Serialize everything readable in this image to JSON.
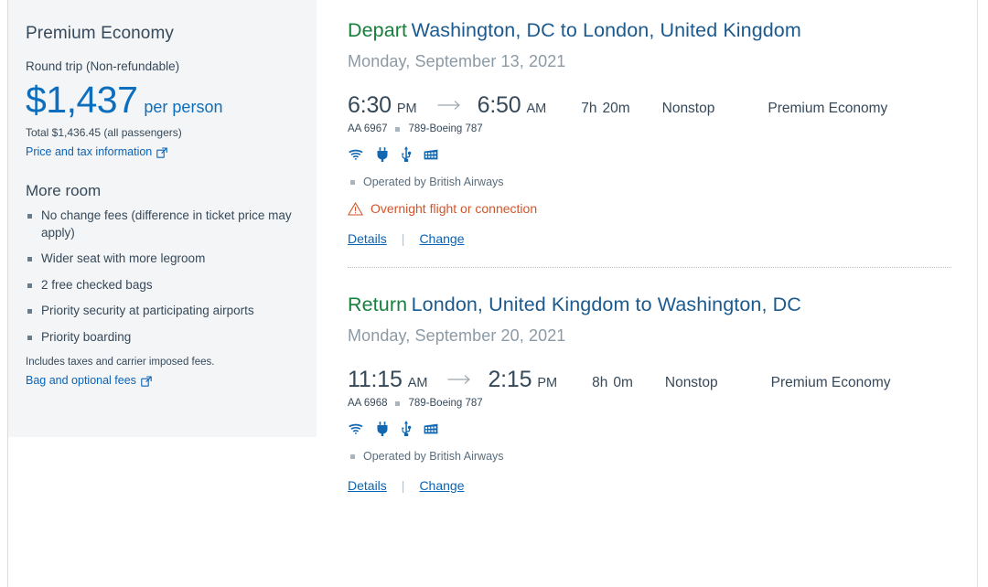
{
  "sidebar": {
    "cabin_title": "Premium Economy",
    "trip_type": "Round trip (Non-refundable)",
    "price": "$1,437",
    "price_unit": "per person",
    "total_line": "Total $1,436.45 (all passengers)",
    "price_tax_link": "Price and tax information",
    "price_tax_link_icon": "external-link-icon",
    "more_room_title": "More room",
    "benefits": [
      "No change fees (difference in ticket price may apply)",
      "Wider seat with more legroom",
      "2 free checked bags",
      "Priority security at participating airports",
      "Priority boarding"
    ],
    "fee_note": "Includes taxes and carrier imposed fees.",
    "bag_fees_link": "Bag and optional fees",
    "bag_fees_link_icon": "external-link-icon"
  },
  "colors": {
    "accent_green": "#17803c",
    "link_blue": "#0a63b5",
    "price_blue": "#0c6ebd",
    "route_blue": "#1b5a8e",
    "text_slate": "#36495a",
    "muted_gray": "#8c9aa5",
    "warning_orange": "#d2552a",
    "sidebar_bg": "#f4f5f6"
  },
  "segments": [
    {
      "direction_label": "Depart",
      "route": "Washington, DC to London, United Kingdom",
      "date": "Monday, September 13, 2021",
      "depart_time": "6:30",
      "depart_meridiem": "PM",
      "arrow_icon": "arrow-right-icon",
      "arrive_time": "6:50",
      "arrive_meridiem": "AM",
      "duration_hours": "7h",
      "duration_minutes": "20m",
      "stops": "Nonstop",
      "cabin": "Premium Economy",
      "flight_number": "AA 6967",
      "aircraft": "789-Boeing 787",
      "amenities": [
        "wifi-icon",
        "power-outlet-icon",
        "usb-port-icon",
        "entertainment-icon"
      ],
      "operated_by": "Operated by British Airways",
      "warning": "Overnight flight or connection",
      "warning_icon": "warning-triangle-icon",
      "details_link": "Details",
      "change_link": "Change"
    },
    {
      "direction_label": "Return",
      "route": "London, United Kingdom to Washington, DC",
      "date": "Monday, September 20, 2021",
      "depart_time": "11:15",
      "depart_meridiem": "AM",
      "arrow_icon": "arrow-right-icon",
      "arrive_time": "2:15",
      "arrive_meridiem": "PM",
      "duration_hours": "8h",
      "duration_minutes": "0m",
      "stops": "Nonstop",
      "cabin": "Premium Economy",
      "flight_number": "AA 6968",
      "aircraft": "789-Boeing 787",
      "amenities": [
        "wifi-icon",
        "power-outlet-icon",
        "usb-port-icon",
        "entertainment-icon"
      ],
      "operated_by": "Operated by British Airways",
      "warning": null,
      "details_link": "Details",
      "change_link": "Change"
    }
  ]
}
